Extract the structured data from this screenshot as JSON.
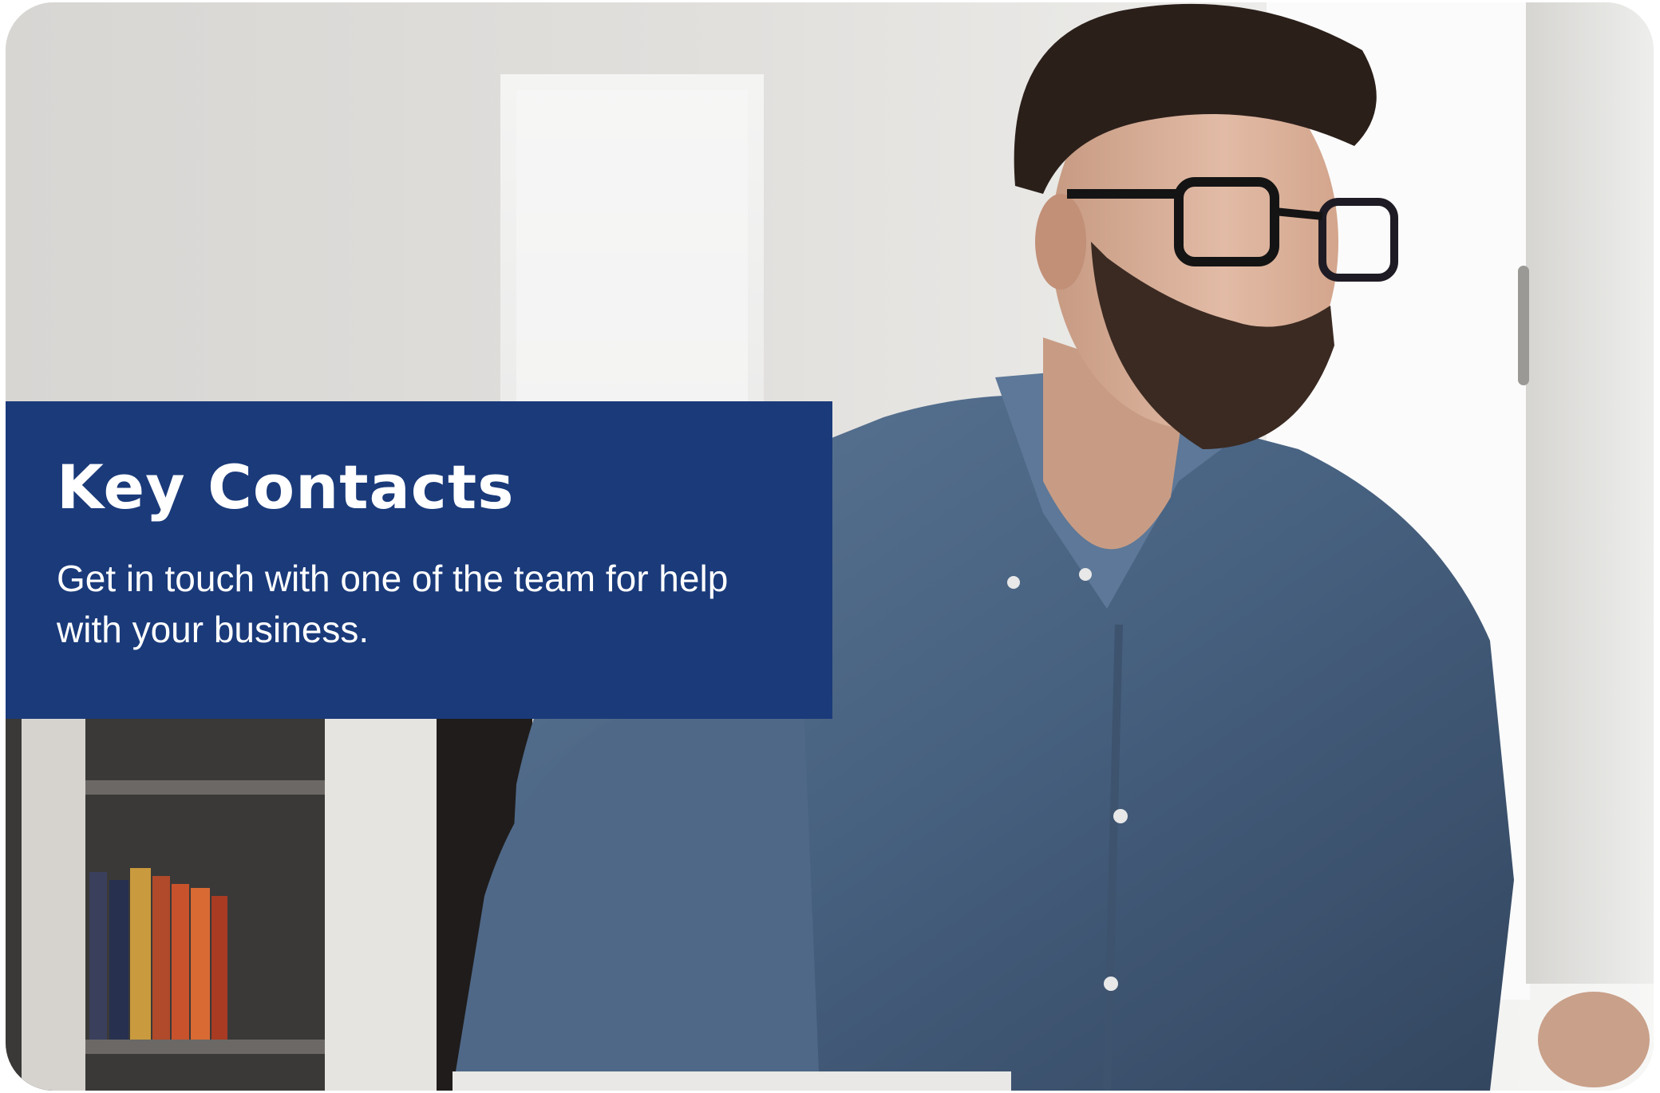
{
  "hero": {
    "image_alt": "Man with glasses and beard in a blue denim shirt working at a computer in an office",
    "panel_color": "#1a3a7a",
    "title": "Key Contacts",
    "subtitle": "Get in touch with one of the team for help with your business."
  }
}
